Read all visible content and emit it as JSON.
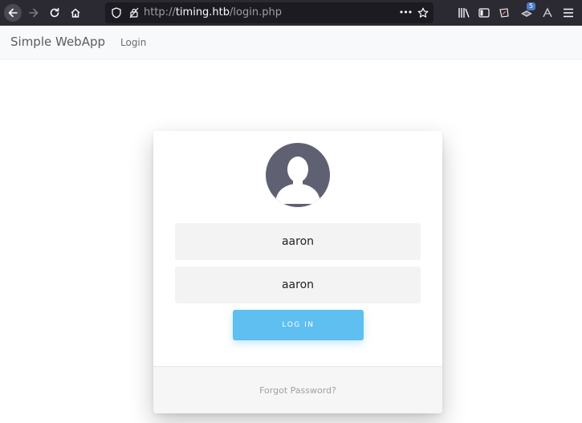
{
  "browser": {
    "url_protocol": "http://",
    "url_host": "timing.htb",
    "url_path": "/login.php",
    "menu_dots": "•••",
    "extension_badge": "5",
    "colors": {
      "toolbar": "#2b2a33",
      "urlbar": "#1c1b22"
    }
  },
  "navbar": {
    "brand": "Simple WebApp",
    "login_link": "Login"
  },
  "login": {
    "username_value": "aaron",
    "password_value": "aaron",
    "submit_label": "LOG IN",
    "forgot_label": "Forgot Password?",
    "colors": {
      "button": "#5fbff0",
      "avatar": "#5f6172"
    }
  }
}
